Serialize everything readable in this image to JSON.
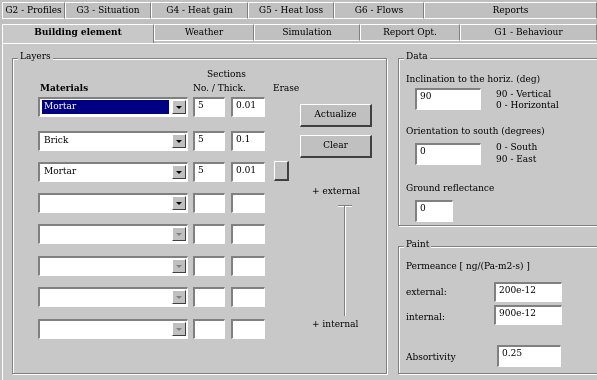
{
  "tabs_row1": [
    "G2 - Profiles",
    "G3 - Situation",
    "G4 - Heat gain",
    "G5 - Heat loss",
    "G6 - Flows",
    "Reports"
  ],
  "tabs_row2": [
    "Building element",
    "Weather",
    "Simulation",
    "Report Opt.",
    "G1 - Behaviour"
  ],
  "active_tab": "Building element",
  "layers": {
    "title": "Layers",
    "sections_header": "Sections",
    "materials_header": "Materials",
    "no_thick_header": "No. / Thick.",
    "erase_header": "Erase",
    "rows": [
      {
        "material": "Mortar",
        "no": "5",
        "thick": "0.01",
        "selected": true
      },
      {
        "material": "Brick",
        "no": "5",
        "thick": "0.1",
        "selected": false
      },
      {
        "material": "Mortar",
        "no": "5",
        "thick": "0.01",
        "selected": false
      },
      {
        "material": "",
        "no": "",
        "thick": "",
        "selected": false
      },
      {
        "material": "",
        "no": "",
        "thick": "",
        "selected": false
      },
      {
        "material": "",
        "no": "",
        "thick": "",
        "selected": false
      },
      {
        "material": "",
        "no": "",
        "thick": "",
        "selected": false
      },
      {
        "material": "",
        "no": "",
        "thick": "",
        "selected": false
      }
    ],
    "actualize_label": "Actualize",
    "clear_label": "Clear",
    "external_label": "+ external",
    "internal_label": "+ internal"
  },
  "data": {
    "title": "Data",
    "inclination_label": "Inclination to the horiz. (deg)",
    "inclination_value": "90",
    "inclination_hint1": "90 - Vertical",
    "inclination_hint2": "0 - Horizontal",
    "orientation_label": "Orientation to south (degrees)",
    "orientation_value": "0",
    "orientation_hint1": "0 - South",
    "orientation_hint2": "90 - East",
    "ground_label": "Ground reflectance",
    "ground_value": "0"
  },
  "paint": {
    "title": "Paint",
    "permeance_label": "Permeance [ ng/(Pa-m2-s) ]",
    "external_label": "external:",
    "external_value": "200e-12",
    "internal_label": "internal:",
    "internal_value": "900e-12",
    "absortivity_label": "Absortivity",
    "absortivity_value": "0.25"
  }
}
